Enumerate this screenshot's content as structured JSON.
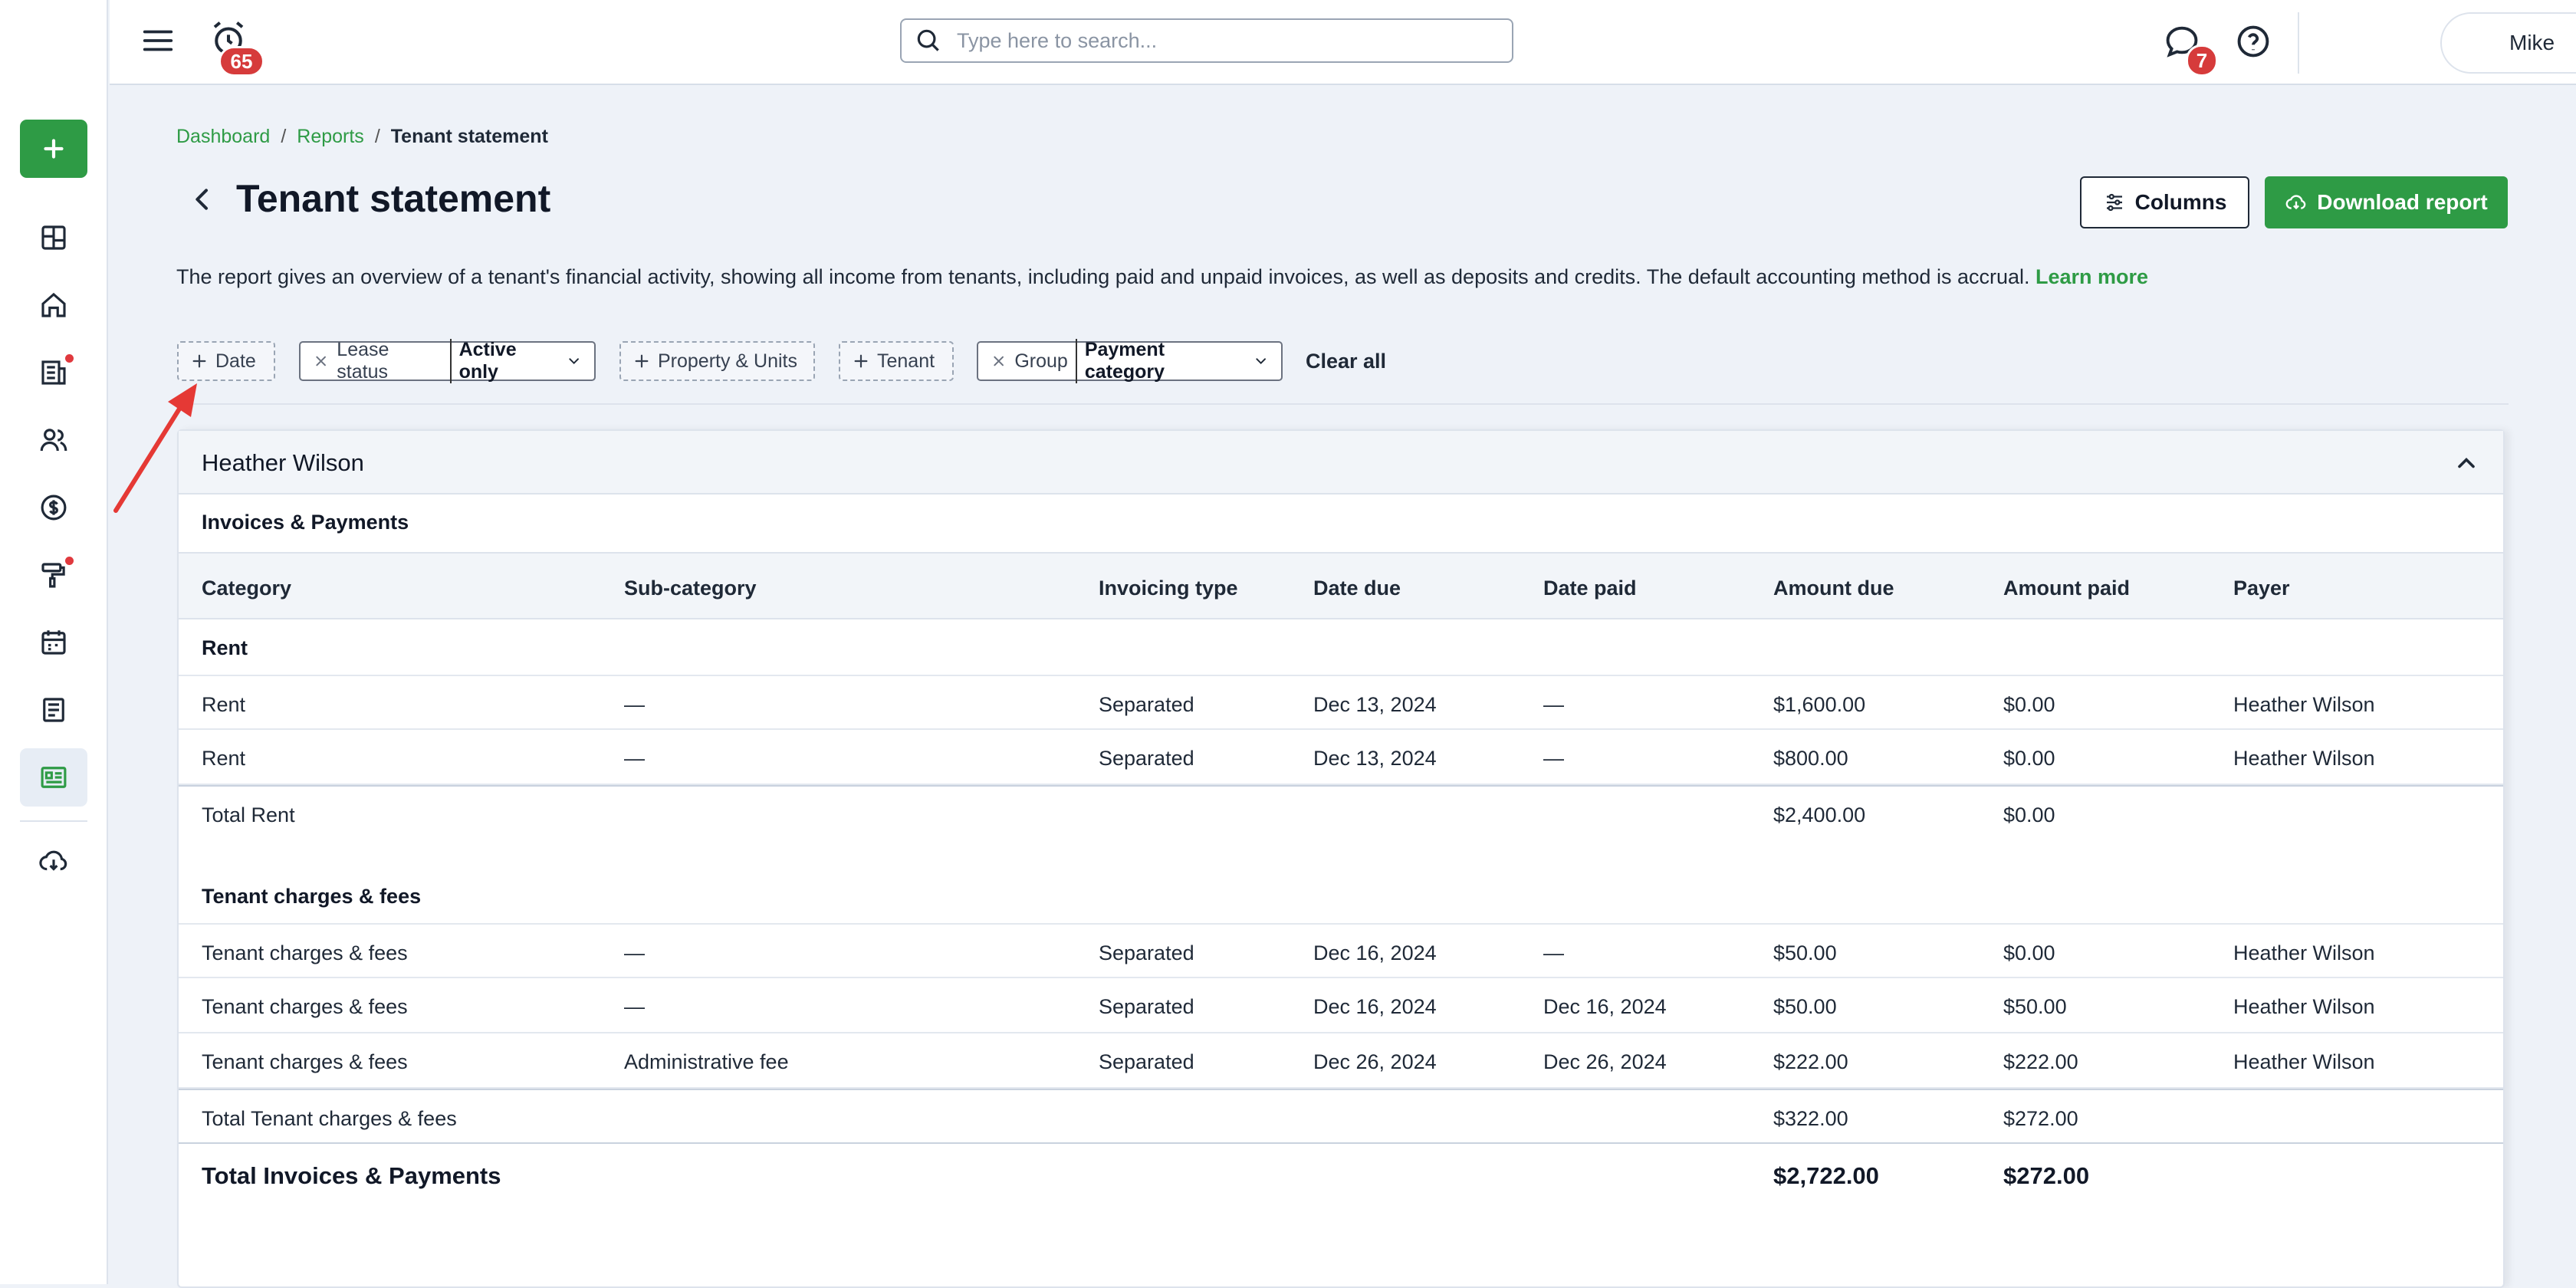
{
  "topbar": {
    "notifications_count": "65",
    "search_placeholder": "Type here to search...",
    "messages_count": "7",
    "user_name": "Mike"
  },
  "breadcrumb": {
    "items": [
      "Dashboard",
      "Reports",
      "Tenant statement"
    ],
    "separator": "/"
  },
  "page": {
    "title": "Tenant statement",
    "columns_label": "Columns",
    "download_label": "Download report",
    "description": "The report gives an overview of a tenant's financial activity, showing all income from tenants, including paid and unpaid invoices, as well as deposits and credits. The default accounting method is accrual.",
    "learn_more": "Learn more"
  },
  "filters": {
    "date": "Date",
    "lease_status_label": "Lease status",
    "lease_status_value": "Active only",
    "property_units": "Property & Units",
    "tenant": "Tenant",
    "group_label": "Group",
    "group_value": "Payment category",
    "clear_all": "Clear all"
  },
  "report": {
    "tenant_name": "Heather Wilson",
    "section_title": "Invoices & Payments",
    "columns": [
      "Category",
      "Sub-category",
      "Invoicing type",
      "Date due",
      "Date paid",
      "Amount due",
      "Amount paid",
      "Payer"
    ],
    "groups": [
      {
        "name": "Rent",
        "rows": [
          [
            "Rent",
            "—",
            "Separated",
            "Dec 13, 2024",
            "—",
            "$1,600.00",
            "$0.00",
            "Heather Wilson"
          ],
          [
            "Rent",
            "—",
            "Separated",
            "Dec 13, 2024",
            "—",
            "$800.00",
            "$0.00",
            "Heather Wilson"
          ]
        ],
        "total_label": "Total Rent",
        "total_due": "$2,400.00",
        "total_paid": "$0.00"
      },
      {
        "name": "Tenant charges & fees",
        "rows": [
          [
            "Tenant charges & fees",
            "—",
            "Separated",
            "Dec 16, 2024",
            "—",
            "$50.00",
            "$0.00",
            "Heather Wilson"
          ],
          [
            "Tenant charges & fees",
            "—",
            "Separated",
            "Dec 16, 2024",
            "Dec 16, 2024",
            "$50.00",
            "$50.00",
            "Heather Wilson"
          ],
          [
            "Tenant charges & fees",
            "Administrative fee",
            "Separated",
            "Dec 26, 2024",
            "Dec 26, 2024",
            "$222.00",
            "$222.00",
            "Heather Wilson"
          ]
        ],
        "total_label": "Total Tenant charges & fees",
        "total_due": "$322.00",
        "total_paid": "$272.00"
      }
    ],
    "grand_total_label": "Total Invoices & Payments",
    "grand_total_due": "$2,722.00",
    "grand_total_paid": "$272.00"
  },
  "colors": {
    "brand_green": "#2e9b45",
    "badge_red": "#d63b3b",
    "annotation_arrow": "#e53935"
  }
}
